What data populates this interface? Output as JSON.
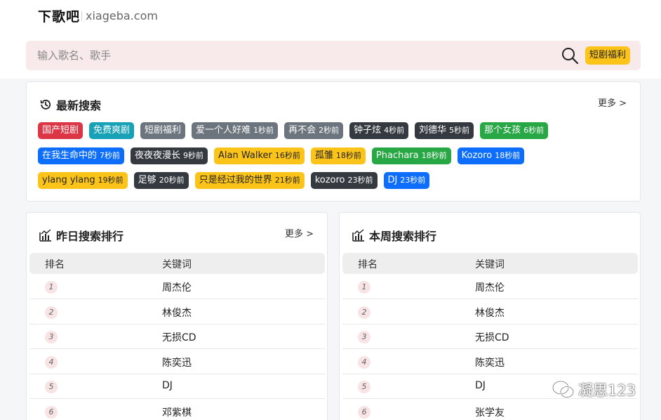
{
  "header": {
    "logo": "下歌吧",
    "domain": "xiageba.com"
  },
  "search": {
    "placeholder": "输入歌名、歌手",
    "promo_label": "短剧福利"
  },
  "recent": {
    "title": "最新搜索",
    "more": "更多 >",
    "rows": [
      [
        {
          "text": "国产短剧",
          "time": "",
          "color": "red"
        },
        {
          "text": "免费爽剧",
          "time": "",
          "color": "teal"
        },
        {
          "text": "短剧福利",
          "time": "",
          "color": "gray"
        },
        {
          "text": "爱一个人好难",
          "time": "1秒前",
          "color": "gray"
        },
        {
          "text": "再不会",
          "time": "2秒前",
          "color": "gray"
        },
        {
          "text": "钟子炫",
          "time": "4秒前",
          "color": "dark"
        },
        {
          "text": "刘德华",
          "time": "5秒前",
          "color": "dark"
        },
        {
          "text": "那个女孩",
          "time": "6秒前",
          "color": "green"
        }
      ],
      [
        {
          "text": "在我生命中的",
          "time": "7秒前",
          "color": "blue"
        },
        {
          "text": "夜夜夜漫长",
          "time": "9秒前",
          "color": "dark"
        },
        {
          "text": "Alan Walker",
          "time": "16秒前",
          "color": "yellow"
        },
        {
          "text": "孤雏",
          "time": "18秒前",
          "color": "yellow"
        },
        {
          "text": "Phachara",
          "time": "18秒前",
          "color": "green"
        },
        {
          "text": "Kozoro",
          "time": "18秒前",
          "color": "blue"
        }
      ],
      [
        {
          "text": "ylang ylang",
          "time": "19秒前",
          "color": "yellow"
        },
        {
          "text": "足够",
          "time": "20秒前",
          "color": "dark"
        },
        {
          "text": "只是经过我的世界",
          "time": "21秒前",
          "color": "yellow"
        },
        {
          "text": "kozoro",
          "time": "23秒前",
          "color": "dark"
        },
        {
          "text": "DJ",
          "time": "23秒前",
          "color": "blue"
        }
      ]
    ]
  },
  "yesterday": {
    "title": "昨日搜索排行",
    "more": "更多 >",
    "col_rank": "排名",
    "col_keyword": "关键词",
    "rows": [
      {
        "rank": "1",
        "keyword": "周杰伦"
      },
      {
        "rank": "2",
        "keyword": "林俊杰"
      },
      {
        "rank": "3",
        "keyword": "无损CD"
      },
      {
        "rank": "4",
        "keyword": "陈奕迅"
      },
      {
        "rank": "5",
        "keyword": "DJ"
      },
      {
        "rank": "6",
        "keyword": "邓紫棋"
      }
    ]
  },
  "week": {
    "title": "本周搜索排行",
    "col_rank": "排名",
    "col_keyword": "关键词",
    "rows": [
      {
        "rank": "1",
        "keyword": "周杰伦"
      },
      {
        "rank": "2",
        "keyword": "林俊杰"
      },
      {
        "rank": "3",
        "keyword": "无损CD"
      },
      {
        "rank": "4",
        "keyword": "陈奕迅"
      },
      {
        "rank": "5",
        "keyword": "DJ"
      },
      {
        "rank": "6",
        "keyword": "张学友"
      }
    ]
  },
  "watermark": {
    "text": "凝思123"
  },
  "colors": {
    "search_bg": "#f8eaeb",
    "accent_yellow": "#fcc419",
    "rank_badge_bg": "#f8e4e5"
  }
}
